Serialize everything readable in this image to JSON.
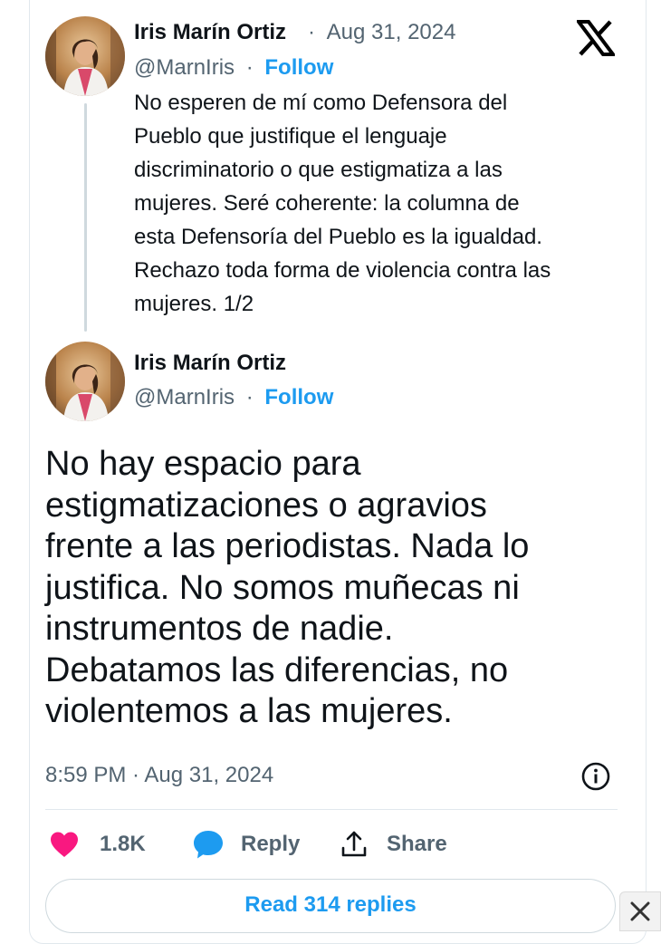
{
  "tweet1": {
    "author_name": "Iris Marín Ortiz",
    "separator": "·",
    "date": "Aug 31, 2024",
    "handle": "@MarnIris",
    "follow_label": "Follow",
    "lines": [
      "No esperen de mí como Defensora del",
      "Pueblo que justifique el lenguaje",
      "discriminatorio o que estigmatiza a las",
      "mujeres. Seré coherente: la columna de",
      "esta Defensoría del Pueblo es la igualdad.",
      "Rechazo toda forma de violencia contra las",
      "mujeres. 1/2"
    ]
  },
  "tweet2": {
    "author_name": "Iris Marín Ortiz",
    "separator": "·",
    "handle": "@MarnIris",
    "follow_label": "Follow",
    "lines": [
      "No hay espacio para",
      "estigmatizaciones o agravios",
      "frente a las periodistas. Nada lo",
      "justifica. No somos muñecas ni",
      "instrumentos de nadie.",
      "Debatamos las diferencias, no",
      "violentemos a las mujeres."
    ],
    "timestamp": "8:59 PM · Aug 31, 2024"
  },
  "actions": {
    "likes_count": "1.8K",
    "reply_label": "Reply",
    "share_label": "Share"
  },
  "read_replies_label": "Read 314 replies",
  "icons": {
    "platform": "x-logo-icon",
    "like": "heart-icon",
    "reply": "speech-bubble-icon",
    "share": "share-upload-icon",
    "info": "info-icon",
    "close": "close-icon"
  },
  "colors": {
    "accent": "#1d9bf0",
    "like": "#f91880",
    "text": "#0f1419",
    "muted": "#536471"
  }
}
